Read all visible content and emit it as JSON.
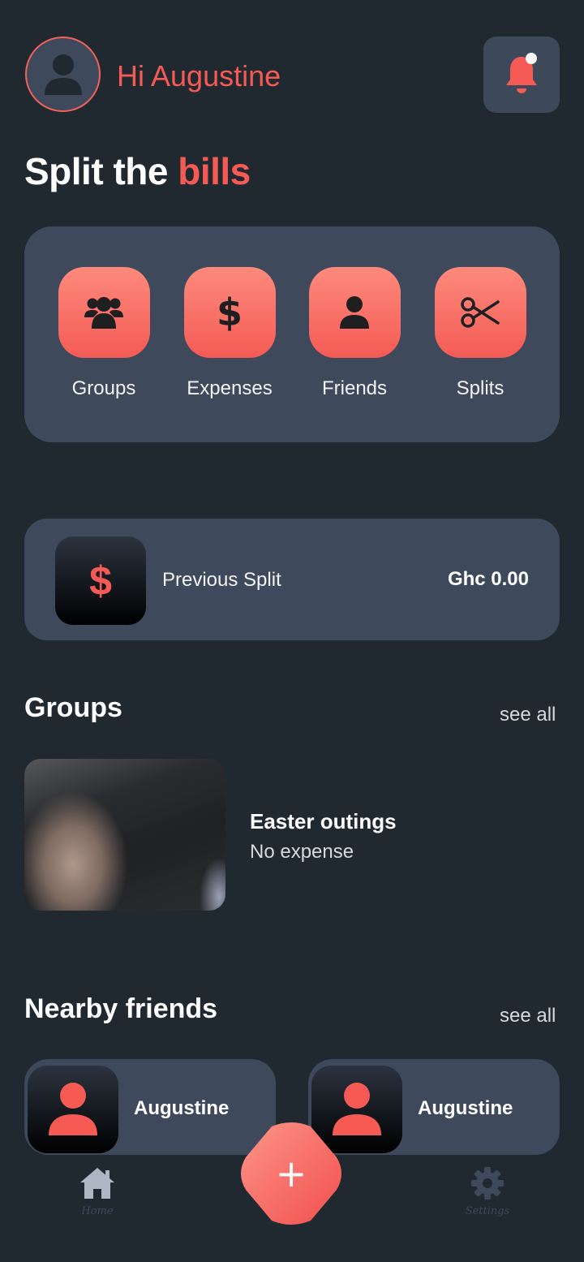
{
  "header": {
    "greeting": "Hi Augustine",
    "avatar_icon": "user-icon",
    "notification_icon": "bell-icon"
  },
  "headline": {
    "prefix": "Split the",
    "accent": "bills"
  },
  "actions": [
    {
      "label": "Groups",
      "icon": "users-icon"
    },
    {
      "label": "Expenses",
      "icon": "dollar-icon"
    },
    {
      "label": "Friends",
      "icon": "user-icon"
    },
    {
      "label": "Splits",
      "icon": "scissors-icon"
    }
  ],
  "previous_split": {
    "icon_glyph": "$",
    "label": "Previous Split",
    "amount": "Ghc 0.00"
  },
  "groups_section": {
    "title": "Groups",
    "see_all": "see all",
    "items": [
      {
        "name": "Easter outings",
        "subtitle": "No expense"
      }
    ]
  },
  "friends_section": {
    "title": "Nearby friends",
    "see_all": "see all",
    "items": [
      {
        "name": "Augustine"
      },
      {
        "name": "Augustine"
      }
    ]
  },
  "bottom_nav": {
    "home_label": "Home",
    "settings_label": "Settings",
    "fab_glyph": "+"
  },
  "colors": {
    "background": "#202830",
    "card": "#3e4a5b",
    "accent": "#f65a55"
  }
}
